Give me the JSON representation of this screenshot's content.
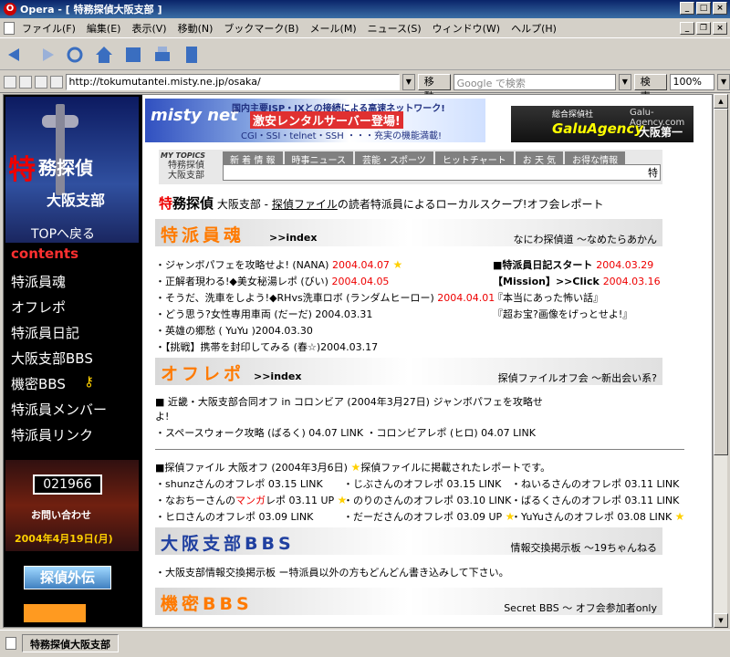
{
  "window": {
    "title": "Opera - [ 特務探偵大阪支部 ]"
  },
  "menu": [
    "ファイル(F)",
    "編集(E)",
    "表示(V)",
    "移動(N)",
    "ブックマーク(B)",
    "メール(M)",
    "ニュース(S)",
    "ウィンドウ(W)",
    "ヘルプ(H)"
  ],
  "address": {
    "url": "http://tokumutantei.misty.ne.jp/osaka/",
    "go_label": "移動",
    "search_placeholder": "Google で検索",
    "search_label": "検索",
    "zoom": "100%"
  },
  "status": {
    "text": "特務探偵大阪支部"
  },
  "left": {
    "logo1": "特",
    "logo2": "務探偵",
    "logo3": "大阪支部",
    "top_link": "TOPへ戻る",
    "contents": "contents",
    "nav": [
      "特派員魂",
      "オフレポ",
      "特派員日記",
      "大阪支部BBS",
      "機密BBS",
      "特派員メンバー",
      "特派員リンク"
    ],
    "counter": "021966",
    "contact": "お問い合わせ",
    "date": "2004年4月19日(月)",
    "gaiden": "探偵外伝"
  },
  "banners": {
    "misty": "misty net",
    "isp": "国内主要ISP・IXとの接続による高速ネットワーク!",
    "rental": "激安レンタルサーバー登場!",
    "features": "CGI・SSI・telnet・SSH ・・・充実の機能満載!",
    "galu_sub": "総合探偵社",
    "galu_name": "GaluAgency",
    "galu_url": "Galu-Agency.com",
    "galu_loc": "大阪第一"
  },
  "topics": {
    "label": "MY TOPICS",
    "label2a": "特務探偵",
    "label2b": "大阪支部",
    "tabs": [
      "新 着 情 報",
      "時事ニュース",
      "芸能・スポーツ",
      "ヒットチャート",
      "お 天 気",
      "お得な情報"
    ],
    "ticker": "特"
  },
  "intro": {
    "a": "特",
    "b": "務探偵",
    "c": " 大阪支部 - ",
    "link": "探偵ファイル",
    "d": "の読者特派員によるローカルスクープ!オフ会レポート"
  },
  "sec1": {
    "title": "特派員魂",
    "index": ">>index",
    "right": "なにわ探偵道 〜なめたらあかん",
    "items": [
      {
        "t": "・ジャンボパフェを攻略せよ! (NANA) ",
        "d": "2004.04.07",
        "star": true
      },
      {
        "t": "・正解者現わる!◆美女秘湯レポ (びい) ",
        "d": "2004.04.05"
      },
      {
        "t": "・そうだ、洗車をしよう!◆RHvs洗車ロボ (ランダムヒーロー) ",
        "d": "2004.04.01"
      },
      {
        "t": "・どう思う?女性専用車両 (だーだ) 2004.03.31",
        "d": ""
      },
      {
        "t": "・英雄の郷愁 ( YuYu )2004.03.30",
        "d": ""
      },
      {
        "t": "・【挑戦】携帯を封印してみる (春☆)2004.03.17",
        "d": ""
      }
    ],
    "right_items": [
      {
        "t": "■特派員日記スタート ",
        "d": "2004.03.29",
        "bold": true
      },
      {
        "t": "【Mission】>>Click ",
        "d": "2004.03.16",
        "bold": true
      },
      {
        "t": "『本当にあった怖い話』",
        "d": ""
      },
      {
        "t": "『超お宝?画像をげっとせよ!』",
        "d": ""
      }
    ]
  },
  "sec2": {
    "title": "オフレポ",
    "index": ">>index",
    "right": "探偵ファイルオフ会 〜新出会い系?",
    "head": "■ 近畿・大阪支部合同オフ in コロンビア (2004年3月27日) ジャンボパフェを攻略せ",
    "head2": "よ!",
    "line": "・スペースウォーク攻略 (ばるく) 04.07 LINK ・コロンビアレポ (ヒロ) 04.07 LINK",
    "head3": "■探偵ファイル 大阪オフ (2004年3月6日) ",
    "head3b": "探偵ファイルに掲載されたレポートです。",
    "grid": [
      [
        "・shunzさんのオフレポ 03.15 LINK",
        "・じぶさんのオフレポ 03.15 LINK",
        "・ねいるさんのオフレポ 03.11 LINK"
      ],
      [
        "・なおちーさんの",
        "・のりのさんのオフレポ 03.10 LINK",
        "・ばるくさんのオフレポ 03.11 LINK"
      ],
      [
        "・ヒロさんのオフレポ 03.09 LINK",
        "・だーださんのオフレポ 03.09 UP",
        "・YuYuさんのオフレポ 03.08 LINK"
      ]
    ],
    "manga": "マンガ",
    "manga_rest": "レポ 03.11 UP"
  },
  "sec3": {
    "title": "大阪支部BBS",
    "right": "情報交換掲示板 〜19ちゃんねる",
    "line": "・大阪支部情報交換掲示板 ー特派員以外の方もどんどん書き込みして下さい。"
  },
  "sec4": {
    "title": "機密BBS",
    "right": "Secret BBS 〜 オフ会参加者only"
  }
}
